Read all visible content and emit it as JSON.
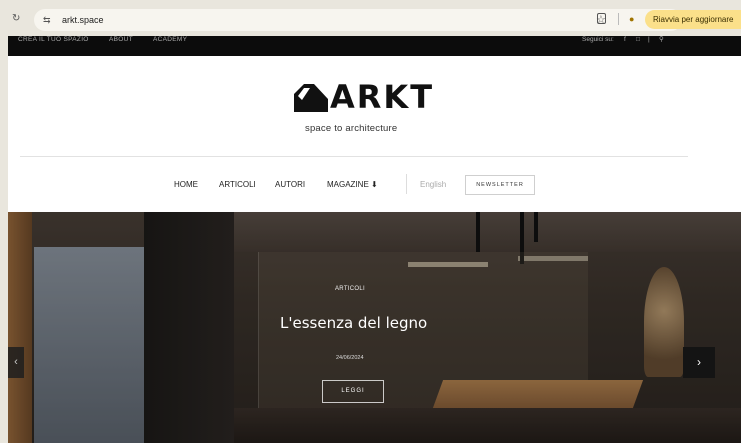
{
  "browser": {
    "url": "arkt.space",
    "update_label": "Riavvia per aggiornare"
  },
  "topbar": {
    "links": [
      "Crea il tuo spazio",
      "About",
      "Academy"
    ],
    "right_text": "Seguici su:"
  },
  "header": {
    "logo_text": "ARKT",
    "tagline": "space to architecture"
  },
  "nav": {
    "items": [
      "HOME",
      "ARTICOLI",
      "AUTORI",
      "MAGAZINE"
    ],
    "language": "English",
    "newsletter": "NEWSLETTER"
  },
  "hero": {
    "category": "ARTICOLI",
    "title": "L'essenza del legno",
    "date": "24/06/2024",
    "button": "LEGGI"
  },
  "colors": {
    "update_bg": "#fbe08a",
    "topbar_bg": "#0c0c0c",
    "hero_bg": "#3b332c"
  }
}
